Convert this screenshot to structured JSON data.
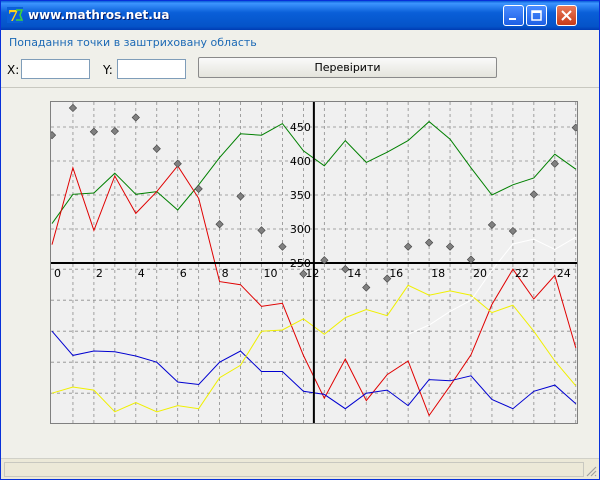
{
  "window": {
    "title": "www.mathros.net.ua",
    "subtitle": "Попадання точки в заштриховану область"
  },
  "form": {
    "x_label": "X:",
    "x_value": "",
    "y_label": "Y:",
    "y_value": "",
    "check_button": "Перевірити"
  },
  "chart_data": {
    "type": "line",
    "x_ticks": [
      "0",
      "2",
      "4",
      "6",
      "8",
      "10",
      "12",
      "14",
      "16",
      "18",
      "20",
      "22",
      "24"
    ],
    "y_ticks": [
      "250",
      "300",
      "350",
      "400",
      "450"
    ],
    "x_range": [
      0,
      25
    ],
    "grid": true,
    "colors": {
      "green": "#008000",
      "red": "#e00000",
      "blue": "#0000d0",
      "yellow": "#f0f000",
      "white": "#ffffff",
      "markers": "#808080"
    },
    "series": [
      {
        "color": "green",
        "values": [
          308,
          351,
          353,
          382,
          351,
          355,
          328,
          365,
          405,
          440,
          438,
          455,
          415,
          393,
          430,
          398,
          413,
          430,
          458,
          432,
          390,
          350,
          365,
          375,
          410,
          388
        ]
      },
      {
        "color": "red",
        "values": [
          277,
          390,
          298,
          378,
          323,
          355,
          393,
          345,
          230,
          225,
          190,
          195,
          111,
          42,
          105,
          38,
          80,
          102,
          14,
          62,
          112,
          193,
          250,
          202,
          240,
          123
        ]
      },
      {
        "color": "blue",
        "values": [
          150,
          111,
          118,
          117,
          110,
          100,
          68,
          64,
          100,
          118,
          85,
          85,
          53,
          48,
          25,
          50,
          55,
          30,
          72,
          70,
          78,
          40,
          25,
          53,
          63,
          33
        ]
      },
      {
        "color": "yellow",
        "values": [
          50,
          60,
          55,
          20,
          35,
          20,
          30,
          25,
          75,
          95,
          150,
          152,
          170,
          145,
          172,
          185,
          175,
          224,
          208,
          215,
          208,
          180,
          192,
          150,
          102,
          62
        ]
      },
      {
        "color": "white",
        "values": [
          null,
          null,
          null,
          null,
          null,
          null,
          null,
          null,
          null,
          null,
          null,
          null,
          null,
          null,
          null,
          null,
          null,
          145,
          160,
          182,
          200,
          248,
          278,
          285,
          270,
          288
        ]
      }
    ],
    "markers": [
      {
        "x": 0,
        "y": 438
      },
      {
        "x": 1,
        "y": 478
      },
      {
        "x": 2,
        "y": 443
      },
      {
        "x": 3,
        "y": 444
      },
      {
        "x": 4,
        "y": 464
      },
      {
        "x": 5,
        "y": 418
      },
      {
        "x": 6,
        "y": 396
      },
      {
        "x": 7,
        "y": 359
      },
      {
        "x": 8,
        "y": 307
      },
      {
        "x": 9,
        "y": 348
      },
      {
        "x": 10,
        "y": 298
      },
      {
        "x": 11,
        "y": 274
      },
      {
        "x": 12,
        "y": 234
      },
      {
        "x": 13,
        "y": 254
      },
      {
        "x": 14,
        "y": 241
      },
      {
        "x": 15,
        "y": 214
      },
      {
        "x": 16,
        "y": 227
      },
      {
        "x": 17,
        "y": 274
      },
      {
        "x": 18,
        "y": 280
      },
      {
        "x": 19,
        "y": 274
      },
      {
        "x": 20,
        "y": 255
      },
      {
        "x": 21,
        "y": 306
      },
      {
        "x": 22,
        "y": 297
      },
      {
        "x": 23,
        "y": 351
      },
      {
        "x": 24,
        "y": 396
      },
      {
        "x": 25,
        "y": 449
      }
    ]
  }
}
